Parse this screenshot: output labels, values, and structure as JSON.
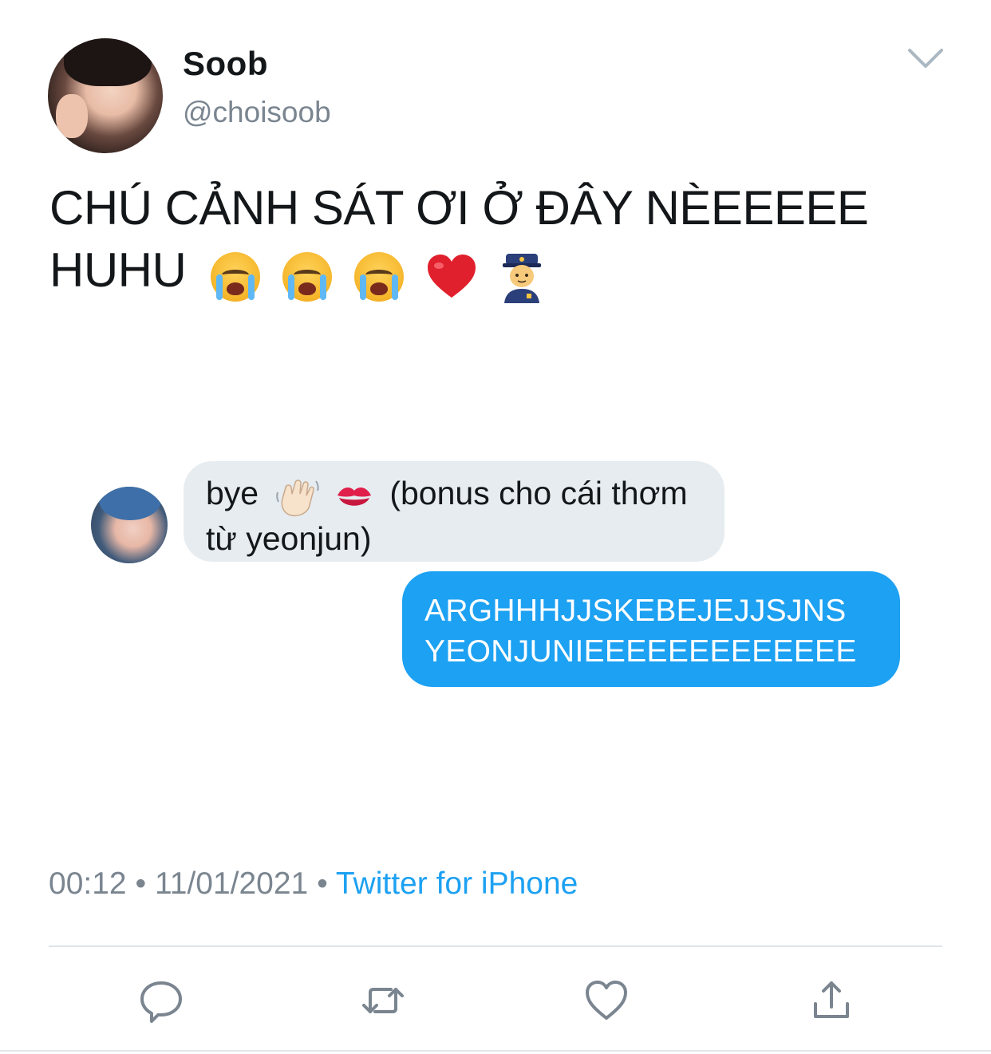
{
  "user": {
    "display_name": "Soob",
    "handle": "@choisoob"
  },
  "tweet": {
    "text_line1": "CHÚ CẢNH SÁT ƠI Ở ĐÂY NÈEEEEE",
    "text_line2": "HUHU",
    "emojis": [
      "loudly-crying-face",
      "loudly-crying-face",
      "loudly-crying-face",
      "red-heart",
      "police-officer"
    ]
  },
  "attached_image": {
    "received_message": {
      "text_before": "bye",
      "emojis": [
        "waving-hand",
        "kiss-mark"
      ],
      "text_after": "(bonus cho cái thơm",
      "text_line2": "từ yeonjun)"
    },
    "sent_message": {
      "line1": "ARGHHHJJSKEBEJEJJSJNS",
      "line2": "YEONJUNIEEEEEEEEEEEEE"
    }
  },
  "meta": {
    "time": "00:12",
    "separator": "•",
    "date": "11/01/2021",
    "source": "Twitter for iPhone"
  },
  "actions": [
    "reply",
    "retweet",
    "like",
    "share"
  ],
  "colors": {
    "accent": "#1da1f2",
    "secondary_text": "#7a8590",
    "bubble_grey": "#e6ecf0"
  }
}
